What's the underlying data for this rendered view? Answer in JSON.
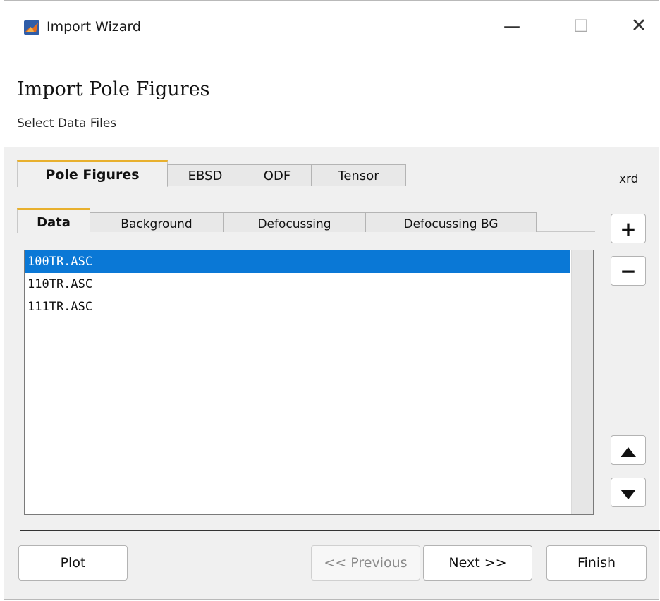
{
  "window": {
    "title": "Import Wizard",
    "minimize": "—",
    "maximize": "☐",
    "close": "✕"
  },
  "header": {
    "title": "Import Pole Figures",
    "subtitle": "Select Data Files"
  },
  "main_tabs": [
    {
      "label": "Pole Figures",
      "active": true
    },
    {
      "label": "EBSD",
      "active": false
    },
    {
      "label": "ODF",
      "active": false
    },
    {
      "label": "Tensor",
      "active": false
    }
  ],
  "format_label": "xrd",
  "sub_tabs": [
    {
      "label": "Data",
      "active": true
    },
    {
      "label": "Background",
      "active": false
    },
    {
      "label": "Defocussing",
      "active": false
    },
    {
      "label": "Defocussing BG",
      "active": false
    }
  ],
  "files": [
    {
      "name": "100TR.ASC",
      "selected": true
    },
    {
      "name": "110TR.ASC",
      "selected": false
    },
    {
      "name": "111TR.ASC",
      "selected": false
    }
  ],
  "side_buttons": {
    "add": "+",
    "remove": "−"
  },
  "footer": {
    "plot": "Plot",
    "previous": "<< Previous",
    "next": "Next >>",
    "finish": "Finish"
  },
  "colors": {
    "accent": "#e8b02e",
    "selection": "#0a78d6"
  }
}
